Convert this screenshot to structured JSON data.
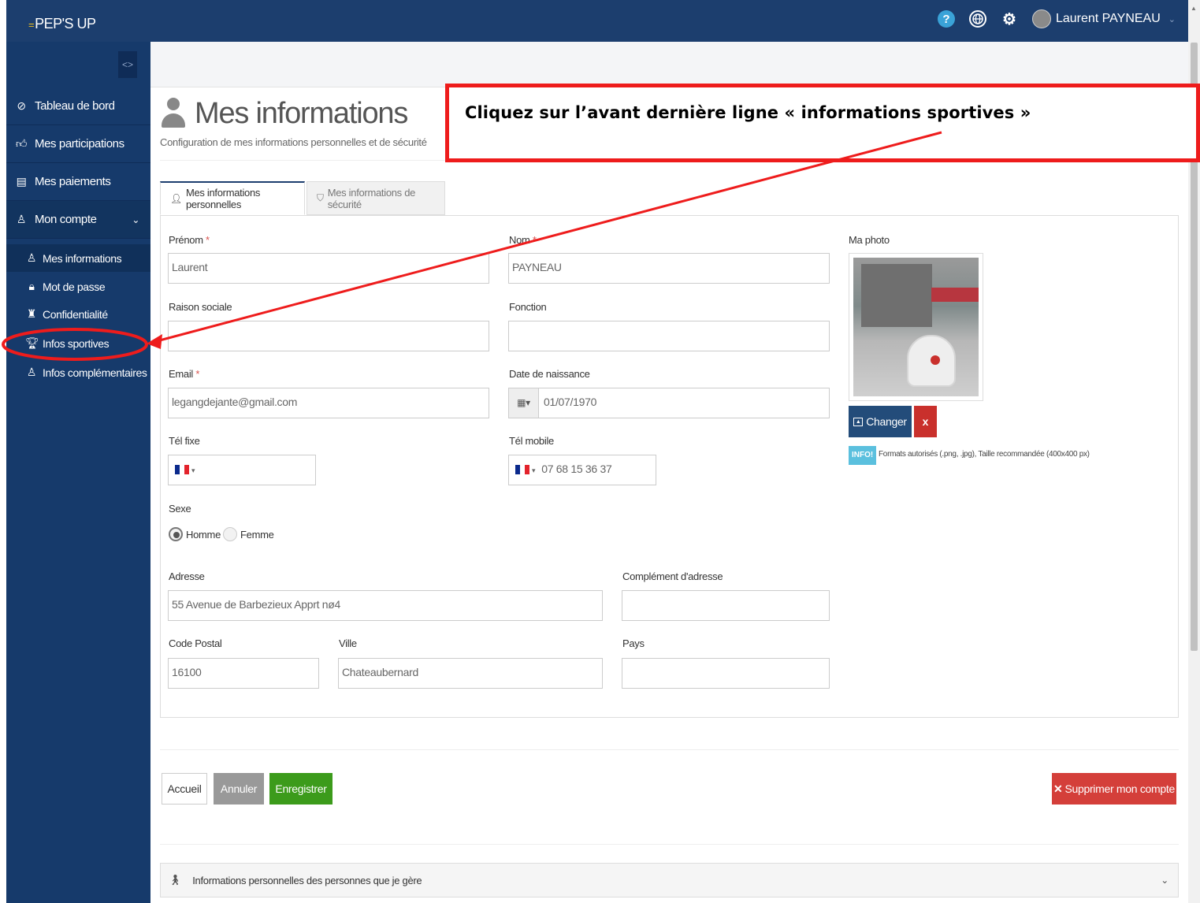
{
  "app": {
    "logo": "PEP'S UP",
    "logo_mark": "="
  },
  "header": {
    "user_name": "Laurent PAYNEAU"
  },
  "sidebar": {
    "items": [
      {
        "label": "Tableau de bord",
        "icon": "dashboard-icon"
      },
      {
        "label": "Mes participations",
        "icon": "thumbs-up-icon"
      },
      {
        "label": "Mes paiements",
        "icon": "payment-card-icon"
      },
      {
        "label": "Mon compte",
        "icon": "user-outline-icon"
      }
    ],
    "sub_items": [
      {
        "label": "Mes informations",
        "icon": "user-outline-icon"
      },
      {
        "label": "Mot de passe",
        "icon": "lock-icon"
      },
      {
        "label": "Confidentialité",
        "icon": "privacy-icon"
      },
      {
        "label": "Infos sportives",
        "icon": "trophy-icon"
      },
      {
        "label": "Infos complémentaires",
        "icon": "users-icon"
      }
    ]
  },
  "page": {
    "title": "Mes informations",
    "subtitle": "Configuration de mes informations personnelles et de sécurité",
    "tabs": [
      {
        "label": "Mes informations personnelles"
      },
      {
        "label": "Mes informations de sécurité"
      }
    ]
  },
  "form": {
    "prenom": {
      "label": "Prénom",
      "value": "Laurent"
    },
    "nom": {
      "label": "Nom",
      "value": "PAYNEAU"
    },
    "photo": {
      "label": "Ma photo",
      "change_label": "Changer",
      "remove_label": "x"
    },
    "raison_sociale": {
      "label": "Raison sociale",
      "value": ""
    },
    "fonction": {
      "label": "Fonction",
      "value": ""
    },
    "email": {
      "label": "Email",
      "value": "legangdejante@gmail.com"
    },
    "date_naissance": {
      "label": "Date de naissance",
      "value": "01/07/1970"
    },
    "tel_fixe": {
      "label": "Tél fixe",
      "value": ""
    },
    "tel_mobile": {
      "label": "Tél mobile",
      "value": "07 68 15 36 37"
    },
    "sexe": {
      "label": "Sexe",
      "options": [
        "Homme",
        "Femme"
      ],
      "selected": "Homme"
    },
    "adresse": {
      "label": "Adresse",
      "value": "55 Avenue de Barbezieux Apprt nø4"
    },
    "complement": {
      "label": "Complément d'adresse",
      "value": ""
    },
    "code_postal": {
      "label": "Code Postal",
      "value": "16100"
    },
    "ville": {
      "label": "Ville",
      "value": "Chateaubernard"
    },
    "pays": {
      "label": "Pays",
      "value": ""
    },
    "info": {
      "badge": "INFO!",
      "text": "Formats autorisés (.png, .jpg), Taille recommandée (400x400 px)"
    }
  },
  "actions": {
    "accueil": "Accueil",
    "annuler": "Annuler",
    "enregistrer": "Enregistrer",
    "supprimer": "Supprimer mon compte"
  },
  "accordion": {
    "label": "Informations personnelles des personnes que je gère"
  },
  "annotation": {
    "text": "Cliquez sur l’avant dernière ligne « informations sportives »",
    "color": "#ee1c1c"
  },
  "colors": {
    "header": "#1c3e6e",
    "sidebar": "#163a6b",
    "success": "#3c9b1b",
    "danger": "#d43f3a",
    "info": "#5bc0de"
  }
}
